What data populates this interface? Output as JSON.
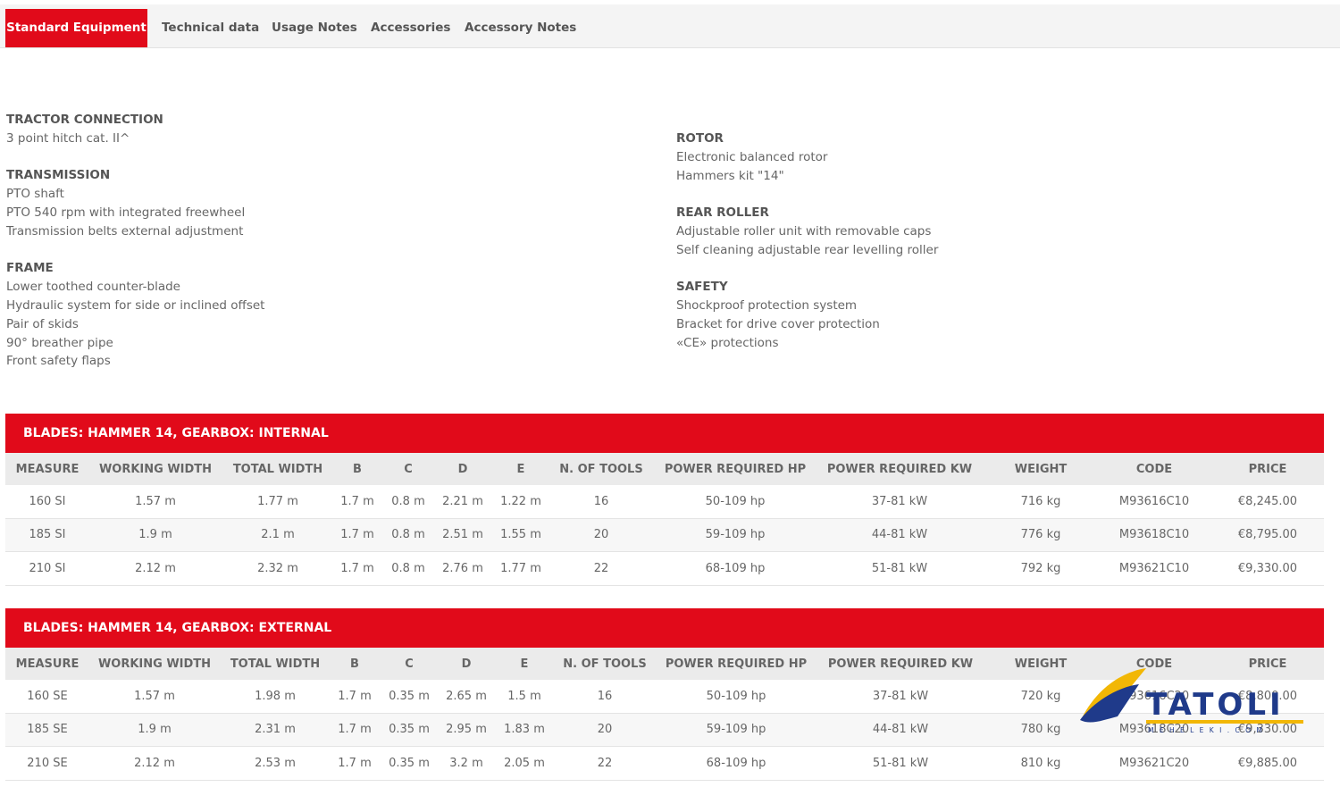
{
  "tabs": [
    "Standard Equipment",
    "Technical data",
    "Usage Notes",
    "Accessories",
    "Accessory Notes"
  ],
  "specs_left": [
    {
      "title": "TRACTOR CONNECTION",
      "items": [
        "3 point hitch cat. II^"
      ]
    },
    {
      "title": "TRANSMISSION",
      "items": [
        "PTO shaft",
        "PTO 540 rpm with integrated freewheel",
        "Transmission belts external adjustment"
      ]
    },
    {
      "title": "FRAME",
      "items": [
        "Lower toothed counter-blade",
        "Hydraulic system for side or inclined offset",
        "Pair of skids",
        "90° breather pipe",
        "Front safety flaps"
      ]
    }
  ],
  "specs_right": [
    {
      "title": "ROTOR",
      "items": [
        "Electronic balanced rotor",
        "Hammers kit \"14\""
      ]
    },
    {
      "title": "REAR ROLLER",
      "items": [
        "Adjustable roller unit with removable caps",
        "Self cleaning adjustable rear levelling roller"
      ]
    },
    {
      "title": "SAFETY",
      "items": [
        "Shockproof protection system",
        "Bracket for drive cover protection",
        "«CE» protections"
      ]
    }
  ],
  "columns": [
    "MEASURE",
    "WORKING WIDTH",
    "TOTAL WIDTH",
    "B",
    "C",
    "D",
    "E",
    "N. OF TOOLS",
    "POWER REQUIRED HP",
    "POWER REQUIRED KW",
    "WEIGHT",
    "CODE",
    "PRICE"
  ],
  "tables": [
    {
      "title": "BLADES: HAMMER 14, GEARBOX: INTERNAL",
      "rows": [
        [
          "160 SI",
          "1.57 m",
          "1.77 m",
          "1.7 m",
          "0.8 m",
          "2.21 m",
          "1.22 m",
          "16",
          "50-109 hp",
          "37-81 kW",
          "716 kg",
          "M93616C10",
          "€8,245.00"
        ],
        [
          "185 SI",
          "1.9 m",
          "2.1 m",
          "1.7 m",
          "0.8 m",
          "2.51 m",
          "1.55 m",
          "20",
          "59-109 hp",
          "44-81 kW",
          "776 kg",
          "M93618C10",
          "€8,795.00"
        ],
        [
          "210 SI",
          "2.12 m",
          "2.32 m",
          "1.7 m",
          "0.8 m",
          "2.76 m",
          "1.77 m",
          "22",
          "68-109 hp",
          "51-81 kW",
          "792 kg",
          "M93621C10",
          "€9,330.00"
        ]
      ]
    },
    {
      "title": "BLADES: HAMMER 14, GEARBOX: EXTERNAL",
      "rows": [
        [
          "160 SE",
          "1.57 m",
          "1.98 m",
          "1.7 m",
          "0.35 m",
          "2.65 m",
          "1.5 m",
          "16",
          "50-109 hp",
          "37-81 kW",
          "720 kg",
          "M93616C20",
          "€8,800.00"
        ],
        [
          "185 SE",
          "1.9 m",
          "2.31 m",
          "1.7 m",
          "0.35 m",
          "2.95 m",
          "1.83 m",
          "20",
          "59-109 hp",
          "44-81 kW",
          "780 kg",
          "M93618C20",
          "€9,330.00"
        ],
        [
          "210 SE",
          "2.12 m",
          "2.53 m",
          "1.7 m",
          "0.35 m",
          "3.2 m",
          "2.05 m",
          "22",
          "68-109 hp",
          "51-81 kW",
          "810 kg",
          "M93621C20",
          "€9,885.00"
        ]
      ]
    }
  ],
  "logo": {
    "text": "TATOLI",
    "tagline": "M E H E L E K I . C O M"
  },
  "colors": {
    "accent": "#e10a1a",
    "header_bg": "#ebebeb",
    "logo_blue": "#1f3a8a",
    "logo_gold": "#f2b705"
  }
}
